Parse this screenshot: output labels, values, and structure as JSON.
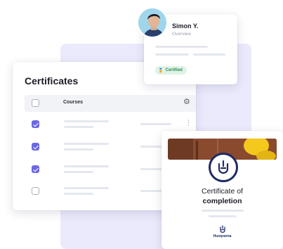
{
  "certificates": {
    "title": "Certificates",
    "column_label": "Courses",
    "rows": [
      {
        "checked": true
      },
      {
        "checked": true
      },
      {
        "checked": true
      },
      {
        "checked": false
      }
    ]
  },
  "profile": {
    "name": "Simon Y.",
    "subtitle": "Overview",
    "badge": "Certified"
  },
  "completion": {
    "line1": "Certificate of",
    "line2": "completion",
    "brand": "Husqvarna"
  },
  "colors": {
    "accent": "#6b68e6",
    "panel_bg": "#ebeafc",
    "brand_navy": "#1e2a63",
    "certified_green": "#2d8d5a"
  }
}
